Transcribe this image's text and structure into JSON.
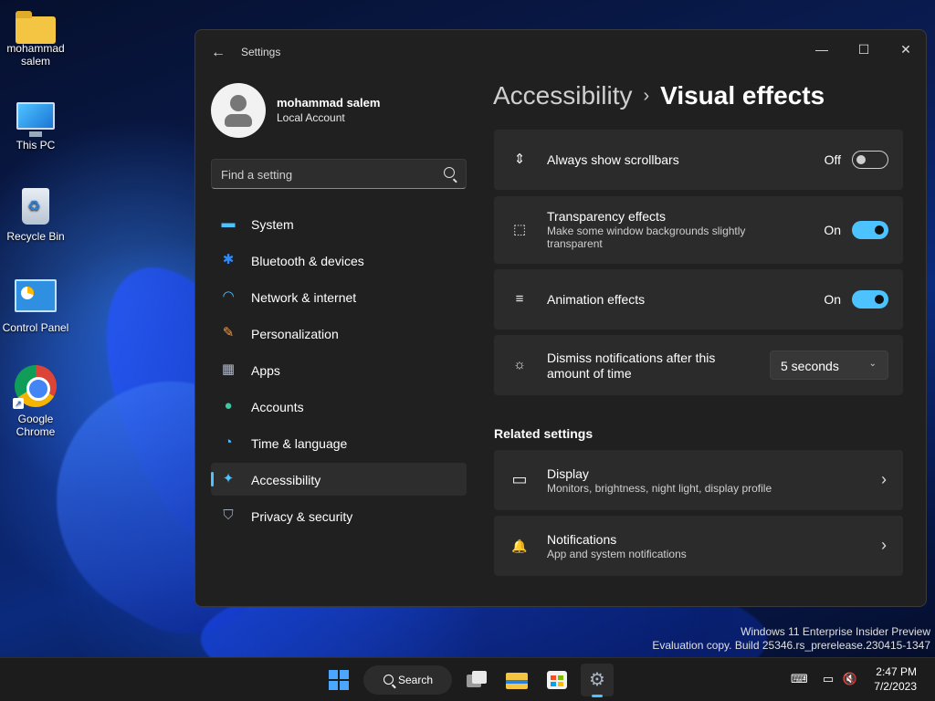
{
  "desktop": {
    "icons": [
      {
        "label": "mohammad salem",
        "icon": "folder-icon"
      },
      {
        "label": "This PC",
        "icon": "this-pc-icon"
      },
      {
        "label": "Recycle Bin",
        "icon": "recycle-bin-icon"
      },
      {
        "label": "Control Panel",
        "icon": "control-panel-icon"
      },
      {
        "label": "Google Chrome",
        "icon": "chrome-icon"
      }
    ],
    "watermark_line1": "Windows 11 Enterprise Insider Preview",
    "watermark_line2": "Evaluation copy. Build 25346.rs_prerelease.230415-1347"
  },
  "window": {
    "title": "Settings",
    "back_icon": "←",
    "minimize_icon": "—",
    "maximize_icon": "☐",
    "close_icon": "✕"
  },
  "profile": {
    "name": "mohammad salem",
    "account_type": "Local Account"
  },
  "search": {
    "placeholder": "Find a setting"
  },
  "nav": {
    "items": [
      {
        "label": "System",
        "icon": "system-icon",
        "glyph": "▬",
        "color": "#4cc2ff"
      },
      {
        "label": "Bluetooth & devices",
        "icon": "bluetooth-icon",
        "glyph": "✱",
        "color": "#2b8cff"
      },
      {
        "label": "Network & internet",
        "icon": "wifi-icon",
        "glyph": "◠",
        "color": "#4cc2ff"
      },
      {
        "label": "Personalization",
        "icon": "brush-icon",
        "glyph": "✎",
        "color": "#f0a050"
      },
      {
        "label": "Apps",
        "icon": "apps-icon",
        "glyph": "▦",
        "color": "#b0b8c8"
      },
      {
        "label": "Accounts",
        "icon": "accounts-icon",
        "glyph": "●",
        "color": "#3cc8a0"
      },
      {
        "label": "Time & language",
        "icon": "globe-clock-icon",
        "glyph": "◔",
        "color": "#4cc2ff"
      },
      {
        "label": "Accessibility",
        "icon": "accessibility-icon",
        "glyph": "✦",
        "color": "#4cc2ff"
      },
      {
        "label": "Privacy & security",
        "icon": "shield-icon",
        "glyph": "⛉",
        "color": "#a0a8b4"
      }
    ],
    "active_index": 7
  },
  "breadcrumb": {
    "parent": "Accessibility",
    "separator": "›",
    "current": "Visual effects"
  },
  "settings": {
    "scrollbars": {
      "title": "Always show scrollbars",
      "state": "Off",
      "icon_glyph": "⇕"
    },
    "transparency": {
      "title": "Transparency effects",
      "subtitle_line1": "Make some window backgrounds slightly",
      "subtitle_line2": "transparent",
      "state": "On",
      "icon_glyph": "⬚"
    },
    "animation": {
      "title": "Animation effects",
      "state": "On",
      "icon_glyph": "≡"
    },
    "dismiss": {
      "title_line1": "Dismiss notifications after this",
      "title_line2": "amount of time",
      "value": "5 seconds",
      "icon_glyph": "☼"
    }
  },
  "related": {
    "heading": "Related settings",
    "display": {
      "title": "Display",
      "subtitle": "Monitors, brightness, night light, display profile",
      "icon_glyph": "▭"
    },
    "notifications": {
      "title": "Notifications",
      "subtitle": "App and system notifications",
      "icon_glyph": "🔔"
    }
  },
  "taskbar": {
    "search_label": "Search",
    "time": "2:47 PM",
    "date": "7/2/2023",
    "accent": "#4cc2ff"
  }
}
